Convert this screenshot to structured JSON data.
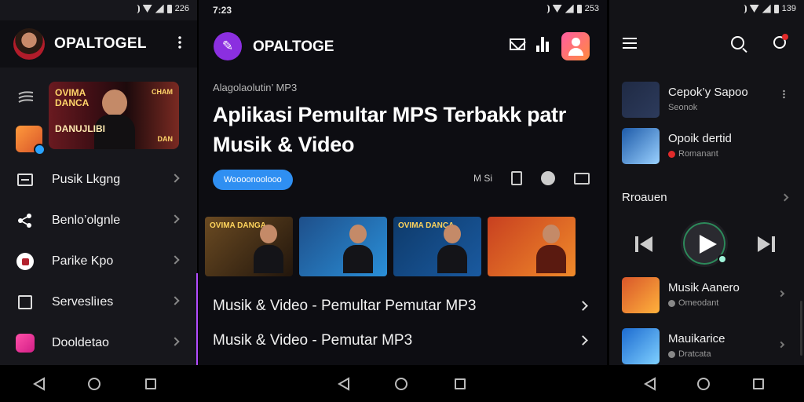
{
  "panel1": {
    "status": {
      "battery_text": "226"
    },
    "app_title": "OPALTOGEL",
    "banner": {
      "text_top": "OVIMA DANCA",
      "text_bottom": "DANUJLIBI",
      "sign_top": "CHAM",
      "sign_bottom": "DAN"
    },
    "menu": [
      {
        "label": "Pusik Lkgng",
        "icon": "card-icon"
      },
      {
        "label": "Benlo’olgnle",
        "icon": "share-icon"
      },
      {
        "label": "Parike Kpo",
        "icon": "red-badge-icon"
      },
      {
        "label": "Servesliıes",
        "icon": "frame-icon"
      },
      {
        "label": "Dooldetao",
        "icon": "gift-icon"
      }
    ]
  },
  "panel2": {
    "status": {
      "time": "7:23",
      "battery_text": "253"
    },
    "app_title": "OPALTOGE",
    "subtitle": "Alagolaolutin’ MP3",
    "headline_line1": "Aplikasi Pemultar MPS Terbakk patr",
    "headline_line2": "Musik & Video",
    "pill_label": "Woooonoolooo",
    "tools": {
      "label": "M Si"
    },
    "thumbnails": [
      {
        "caption": "OVIMA DANGA",
        "colors": [
          "#5a3a1a",
          "#2a1a10"
        ]
      },
      {
        "caption": "",
        "colors": [
          "#1e4f8a",
          "#2a8fd8"
        ]
      },
      {
        "caption": "OVIMA DANCA",
        "colors": [
          "#0e3a6a",
          "#1a5aa0"
        ]
      },
      {
        "caption": "",
        "colors": [
          "#c84020",
          "#f08a2a"
        ]
      }
    ],
    "list": [
      {
        "text": "Musik & Video - Pemultar Pemutar MP3"
      },
      {
        "text": "Musik & Video - Pemutar MP3"
      }
    ]
  },
  "panel3": {
    "status": {
      "battery_text": "139"
    },
    "tracks_top": [
      {
        "title": "Cepok’y Sapoo",
        "subtitle": "Seonok",
        "art": [
          "#1f2a44",
          "#2d3b5c"
        ]
      },
      {
        "title": "Opoik dertid",
        "subtitle": "Romanant",
        "art": [
          "#1d5aa8",
          "#9ad1ff"
        ]
      }
    ],
    "section_title": "Rroauen",
    "tracks_bottom": [
      {
        "title": "Musik Aanero",
        "subtitle": "Omeodant",
        "art": [
          "#d8562a",
          "#ffb23c"
        ]
      },
      {
        "title": "Mauikarice",
        "subtitle": "Dratcata",
        "art": [
          "#1c6bd0",
          "#7fd0ff"
        ]
      }
    ]
  }
}
